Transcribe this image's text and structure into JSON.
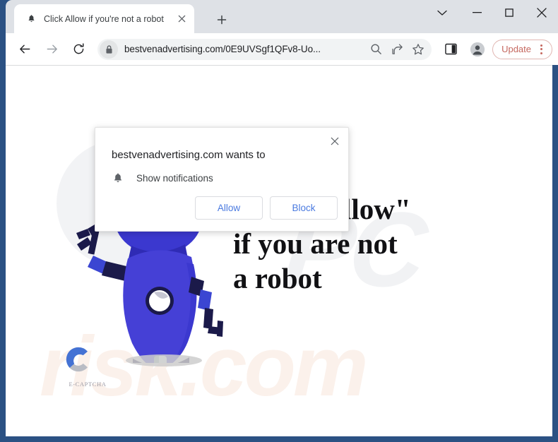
{
  "window": {
    "controls": [
      {
        "name": "chevron-down",
        "glyph": "⌄"
      },
      {
        "name": "minimize",
        "glyph": "—"
      },
      {
        "name": "maximize",
        "glyph": "□"
      },
      {
        "name": "close",
        "glyph": "✕"
      }
    ]
  },
  "tab": {
    "title": "Click Allow if you're not a robot",
    "favicon": "bell-icon",
    "close_glyph": "✕",
    "newtab_glyph": "+"
  },
  "toolbar": {
    "back_glyph": "←",
    "forward_glyph": "→",
    "reload_glyph": "⟳",
    "lock_icon": "lock-icon",
    "url": "bestvenadvertising.com/0E9UVSgf1QFv8-Uo...",
    "search_icon": "search-icon",
    "share_icon": "share-icon",
    "bookmark_icon": "star-icon",
    "side_panel_icon": "side-panel-icon",
    "profile_icon": "profile-avatar-icon",
    "update_label": "Update",
    "menu_icon": "kebab-menu-icon"
  },
  "permission_dialog": {
    "title": "bestvenadvertising.com wants to",
    "permission_icon": "bell-icon",
    "permission_text": "Show notifications",
    "allow_label": "Allow",
    "block_label": "Block",
    "close_glyph": "✕"
  },
  "page": {
    "headline": "Click \"Allow\"\nif you are not\na robot",
    "headline_lines": [
      "Click \"Allow\"",
      "if you are not",
      "a robot"
    ],
    "watermark_gray": "PC",
    "watermark_peach": "risk.com",
    "captcha_logo_label": "E-CAPTCHA",
    "robot_illustration": "blue-robot-character"
  },
  "colors": {
    "window_border": "#2b5183",
    "tabstrip_bg": "#dee1e6",
    "omnibox_bg": "#f1f3f4",
    "update_accent": "#c5685f",
    "dialog_link_blue": "#4a7ae0",
    "robot_body_blue": "#4540d6",
    "robot_visor_teal": "#153a4c",
    "watermark_peach": "#fbf1eb",
    "watermark_gray": "#f1f2f4"
  }
}
